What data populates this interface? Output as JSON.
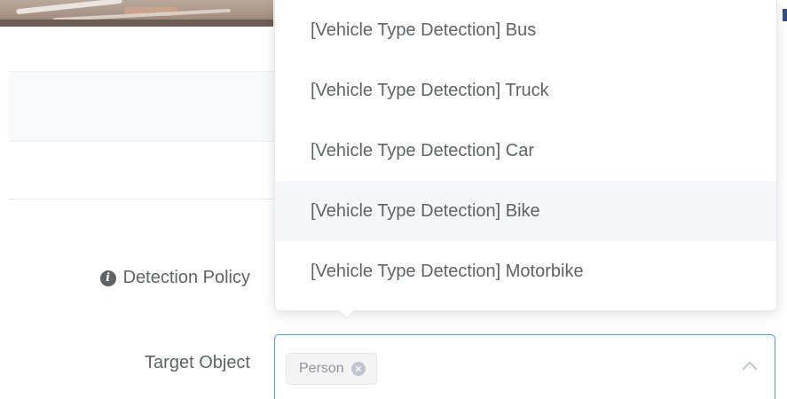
{
  "form": {
    "detection_policy_label": "Detection Policy",
    "target_object_label": "Target Object",
    "selected_tags": [
      "Person"
    ]
  },
  "dropdown": {
    "options": [
      "[Vehicle Type Detection] Bus",
      "[Vehicle Type Detection] Truck",
      "[Vehicle Type Detection] Car",
      "[Vehicle Type Detection] Bike",
      "[Vehicle Type Detection] Motorbike"
    ],
    "hovered_option": "[Vehicle Type Detection] Bike"
  },
  "icons": {
    "info": "info-icon",
    "tag_close": "close-circle-icon",
    "select_arrow": "chevron-up-icon"
  },
  "colors": {
    "focus_border": "#409eff",
    "hover_bg": "#f5f7fa",
    "text": "#606266",
    "tag_bg": "#f4f4f5"
  }
}
